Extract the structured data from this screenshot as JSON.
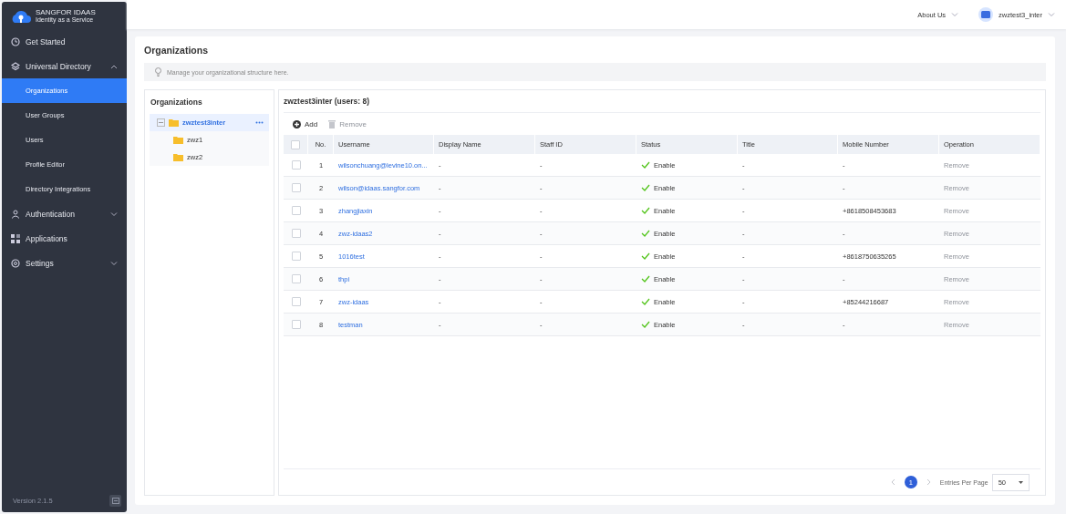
{
  "sidebar": {
    "brand": {
      "name": "SANGFOR IDAAS",
      "tagline": "Identity as a Service"
    },
    "items": [
      {
        "label": "Get Started",
        "selected": false
      },
      {
        "label": "Universal Directory",
        "selected": false,
        "expanded": true,
        "children": [
          {
            "label": "Organizations",
            "selected": true
          },
          {
            "label": "User Groups",
            "selected": false
          },
          {
            "label": "Users",
            "selected": false
          },
          {
            "label": "Profile Editor",
            "selected": false
          },
          {
            "label": "Directory Integrations",
            "selected": false
          }
        ]
      },
      {
        "label": "Authentication",
        "selected": false,
        "expanded": false
      },
      {
        "label": "Applications",
        "selected": false
      },
      {
        "label": "Settings",
        "selected": false,
        "expanded": false
      }
    ],
    "version": "Version 2.1.5"
  },
  "header": {
    "about": "About Us",
    "user": "zwztest3_inter"
  },
  "page": {
    "title": "Organizations",
    "tip": "Manage your organizational structure here."
  },
  "tree": {
    "title": "Organizations",
    "nodes": [
      {
        "label": "zwztest3inter",
        "selected": true,
        "expanded": true,
        "children": [
          {
            "label": "zwz1",
            "selected": false
          },
          {
            "label": "zwz2",
            "selected": false
          }
        ]
      }
    ]
  },
  "table": {
    "title": "zwztest3inter (users: 8)",
    "actions": [
      {
        "label": "Add",
        "disabled": false
      },
      {
        "label": "Remove",
        "disabled": true
      }
    ],
    "all_checked": false,
    "columns": [
      "No.",
      "Username",
      "Display Name",
      "Staff ID",
      "Status",
      "Title",
      "Mobile Number",
      "Operation"
    ],
    "rows": [
      {
        "checked": false,
        "no": "1",
        "username": "wilsonchuang@levine10.on...",
        "display_name": "-",
        "staff_id": "-",
        "status": "Enable",
        "enabled": true,
        "title": "-",
        "mobile": "-",
        "operation": {
          "label": "Remove",
          "disabled": true
        }
      },
      {
        "checked": false,
        "no": "2",
        "username": "wilson@idaas.sangfor.com",
        "display_name": "-",
        "staff_id": "-",
        "status": "Enable",
        "enabled": true,
        "title": "-",
        "mobile": "-",
        "operation": {
          "label": "Remove",
          "disabled": true
        }
      },
      {
        "checked": false,
        "no": "3",
        "username": "zhangjiaxin",
        "display_name": "-",
        "staff_id": "-",
        "status": "Enable",
        "enabled": true,
        "title": "-",
        "mobile": "+8618508453683",
        "operation": {
          "label": "Remove",
          "disabled": true
        }
      },
      {
        "checked": false,
        "no": "4",
        "username": "zwz-idaas2",
        "display_name": "-",
        "staff_id": "-",
        "status": "Enable",
        "enabled": true,
        "title": "-",
        "mobile": "-",
        "operation": {
          "label": "Remove",
          "disabled": true
        }
      },
      {
        "checked": false,
        "no": "5",
        "username": "1016test",
        "display_name": "-",
        "staff_id": "-",
        "status": "Enable",
        "enabled": true,
        "title": "-",
        "mobile": "+8618750635265",
        "operation": {
          "label": "Remove",
          "disabled": true
        }
      },
      {
        "checked": false,
        "no": "6",
        "username": "thpi",
        "display_name": "-",
        "staff_id": "-",
        "status": "Enable",
        "enabled": true,
        "title": "-",
        "mobile": "-",
        "operation": {
          "label": "Remove",
          "disabled": true
        }
      },
      {
        "checked": false,
        "no": "7",
        "username": "zwz-idaas",
        "display_name": "-",
        "staff_id": "-",
        "status": "Enable",
        "enabled": true,
        "title": "-",
        "mobile": "+85244216687",
        "operation": {
          "label": "Remove",
          "disabled": true
        }
      },
      {
        "checked": false,
        "no": "8",
        "username": "testman",
        "display_name": "-",
        "staff_id": "-",
        "status": "Enable",
        "enabled": true,
        "title": "-",
        "mobile": "-",
        "operation": {
          "label": "Remove",
          "disabled": true
        }
      }
    ],
    "pagination": {
      "pages": [
        {
          "label": "1",
          "selected": true
        }
      ],
      "per_page_label": "Entries Per Page",
      "per_page": "50"
    }
  }
}
